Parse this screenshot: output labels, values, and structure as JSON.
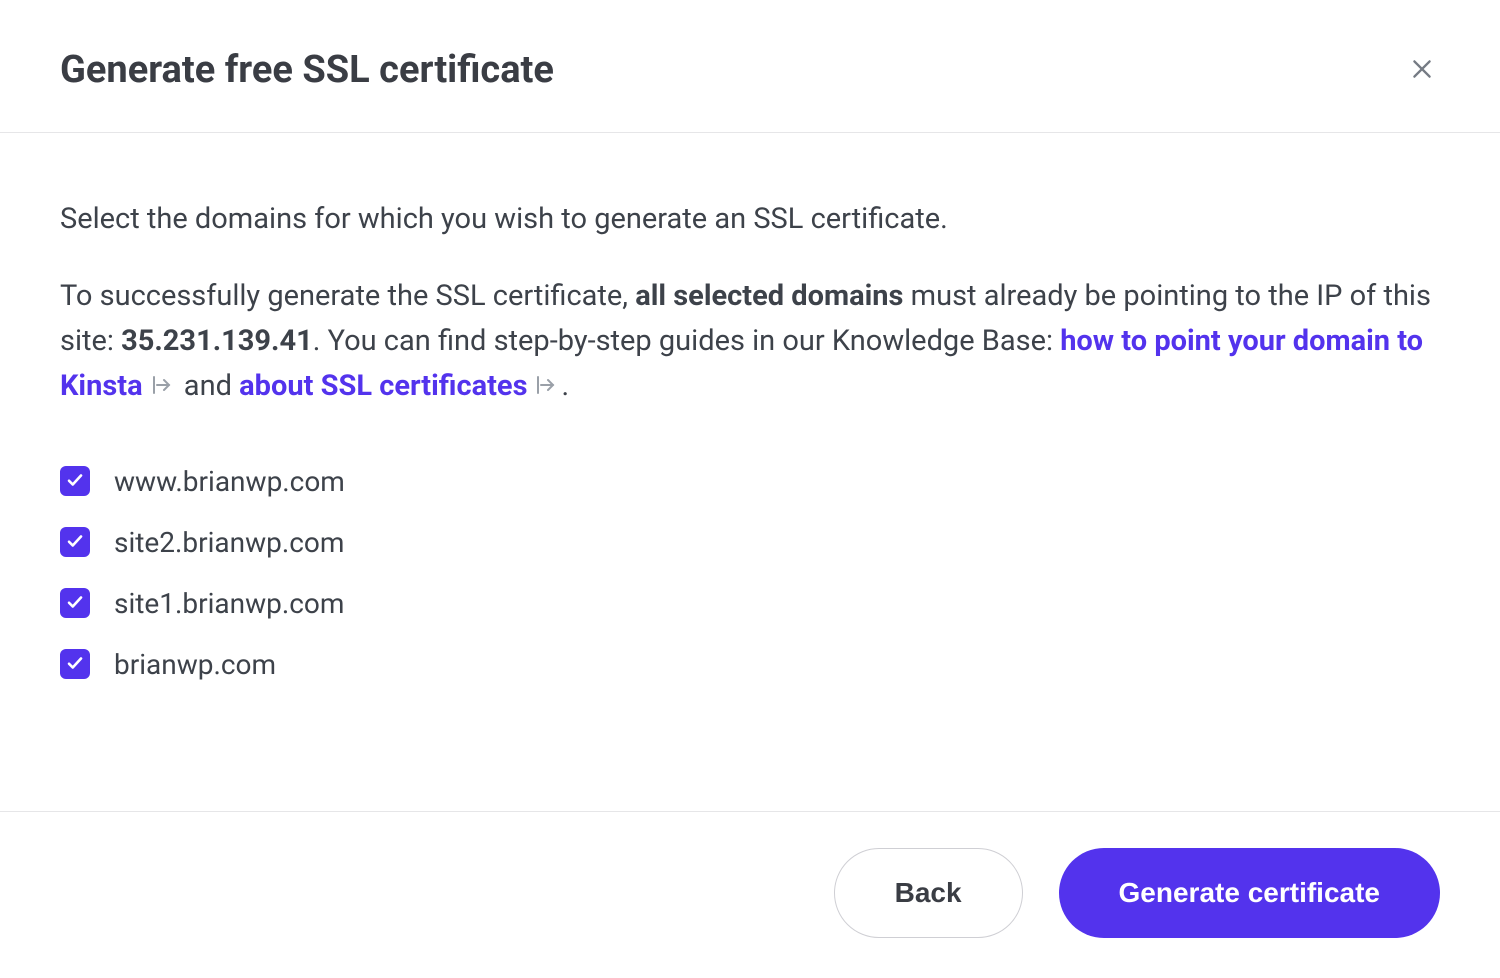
{
  "header": {
    "title": "Generate free SSL certificate"
  },
  "body": {
    "intro": "Select the domains for which you wish to generate an SSL certificate.",
    "info_prefix": "To successfully generate the SSL certificate, ",
    "info_bold": "all selected domains",
    "info_mid": " must already be pointing to the IP of this site: ",
    "ip": "35.231.139.41",
    "info_suffix": ". You can find step-by-step guides in our Knowledge Base: ",
    "link1": "how to point your domain to Kinsta",
    "link_sep": " and ",
    "link2": "about SSL certificates",
    "period": "."
  },
  "domains": [
    {
      "label": "www.brianwp.com",
      "checked": true
    },
    {
      "label": "site2.brianwp.com",
      "checked": true
    },
    {
      "label": "site1.brianwp.com",
      "checked": true
    },
    {
      "label": "brianwp.com",
      "checked": true
    }
  ],
  "footer": {
    "back": "Back",
    "generate": "Generate certificate"
  },
  "colors": {
    "accent": "#5333ed"
  }
}
